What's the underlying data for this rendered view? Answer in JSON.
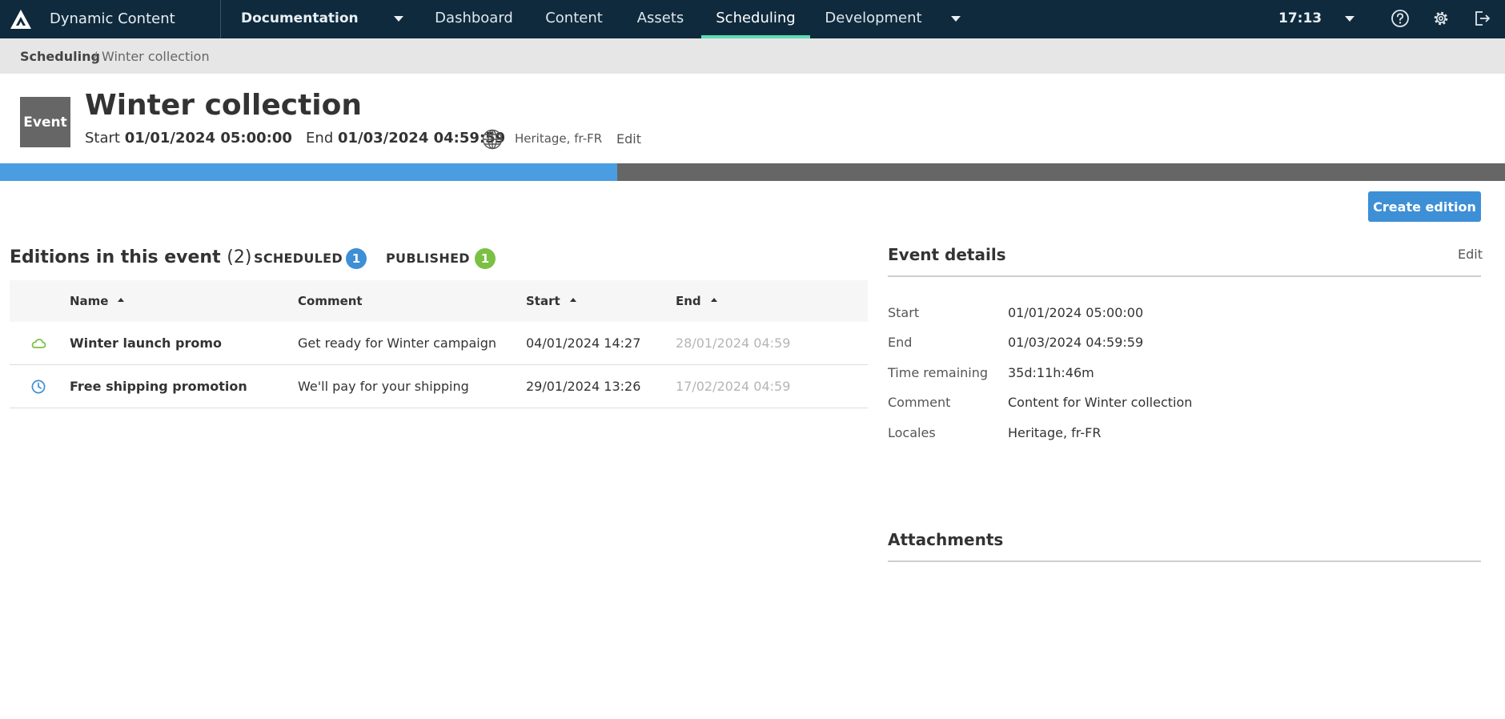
{
  "topnav": {
    "app_title": "Dynamic Content",
    "hub": "Documentation",
    "items": [
      {
        "label": "Dashboard"
      },
      {
        "label": "Content"
      },
      {
        "label": "Assets"
      },
      {
        "label": "Scheduling",
        "active": true
      },
      {
        "label": "Development"
      }
    ],
    "time": "17:13",
    "icons": [
      "logo-icon",
      "help-icon",
      "gear-icon",
      "logout-icon"
    ],
    "colors": {
      "background": "#0f2a3d",
      "active_indicator": "#5fdcb6"
    }
  },
  "breadcrumb": {
    "root": "Scheduling",
    "separator": "/",
    "current": "Winter collection"
  },
  "header": {
    "badge": "Event",
    "title": "Winter collection",
    "start_label": "Start",
    "start_value": "01/01/2024 05:00:00",
    "end_label": "End",
    "end_value": "01/03/2024 04:59:59",
    "locales": "Heritage, fr-FR",
    "edit_label": "Edit",
    "progress": 0.41
  },
  "actions": {
    "create_edition": "Create edition"
  },
  "editions": {
    "title": "Editions in this event",
    "count": "(2)",
    "statuses": [
      {
        "label": "SCHEDULED",
        "count": "1",
        "color": "#3d8fd6"
      },
      {
        "label": "PUBLISHED",
        "count": "1",
        "color": "#7ac143"
      }
    ],
    "columns": [
      "Name",
      "Comment",
      "Start",
      "End"
    ],
    "rows": [
      {
        "status_icon": "cloud-icon",
        "name": "Winter launch promo",
        "comment": "Get ready for Winter campaign",
        "start": "04/01/2024 14:27",
        "end": "28/01/2024 04:59"
      },
      {
        "status_icon": "clock-icon",
        "name": "Free shipping promotion",
        "comment": "We'll pay for your shipping",
        "start": "29/01/2024 13:26",
        "end": "17/02/2024 04:59"
      }
    ]
  },
  "details": {
    "title": "Event details",
    "edit_label": "Edit",
    "fields": [
      {
        "label": "Start",
        "value": "01/01/2024 05:00:00"
      },
      {
        "label": "End",
        "value": "01/03/2024 04:59:59"
      },
      {
        "label": "Time remaining",
        "value": "35d:11h:46m"
      },
      {
        "label": "Comment",
        "value": "Content for Winter collection"
      },
      {
        "label": "Locales",
        "value": "Heritage, fr-FR"
      }
    ]
  },
  "attachments": {
    "title": "Attachments"
  }
}
